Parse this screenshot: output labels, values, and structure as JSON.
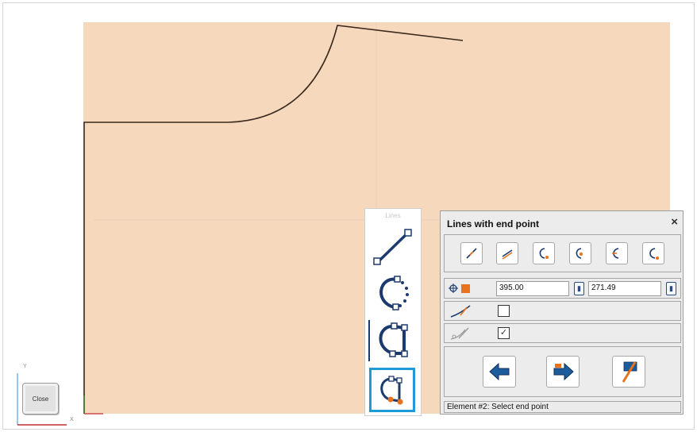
{
  "viewport": {
    "view_cube_label": "Close",
    "axis_y": "Y",
    "axis_x": "X"
  },
  "tool_palette": {
    "title": "Lines",
    "tools": [
      {
        "name": "line-tool",
        "icon": "straight-line-icon"
      },
      {
        "name": "arc-tool",
        "icon": "arc-dotted-icon"
      },
      {
        "name": "curve-tool",
        "icon": "curve-nodes-icon"
      },
      {
        "name": "end-point-line-tool",
        "icon": "curve-end-point-icon",
        "selected": true
      }
    ]
  },
  "dialog": {
    "title": "Lines with end point",
    "close_label": "×",
    "modes": [
      "straight-line-icon",
      "parallel-line-icon",
      "curve-1-icon",
      "curve-2-icon",
      "curve-3-icon",
      "curve-4-icon"
    ],
    "coords": {
      "x_value": "395.00",
      "y_value": "271.49"
    },
    "check1": {
      "icon": "curve-pen-icon",
      "checked": false
    },
    "check2": {
      "icon": "pencil-tangent-icon",
      "checked": true,
      "mark": "✓"
    },
    "nav": [
      "back-arrow-icon",
      "forward-arrow-icon",
      "finish-flag-icon"
    ],
    "status": "Element #2: Select end point"
  },
  "colors": {
    "drawing_area": "#f6d9bd",
    "accent_orange": "#e8731c",
    "icon_navy": "#1d3a6e",
    "selection_blue": "#1e9bd6"
  }
}
